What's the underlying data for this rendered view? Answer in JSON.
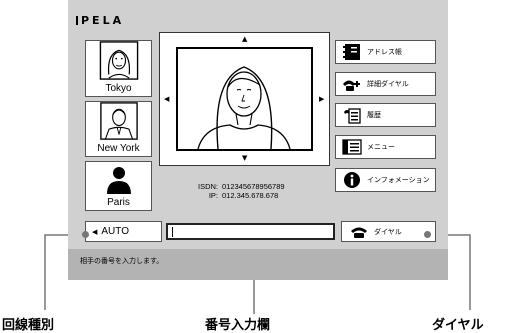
{
  "app": {
    "logo": "PELA"
  },
  "contacts": [
    {
      "name": "Tokyo",
      "icon": "woman-portrait-icon"
    },
    {
      "name": "New York",
      "icon": "man-portrait-icon"
    },
    {
      "name": "Paris",
      "icon": "person-silhouette-icon"
    }
  ],
  "preview": {
    "isdn_label": "ISDN:",
    "isdn_value": "012345678956789",
    "ip_label": "IP:",
    "ip_value": "012.345.678.678"
  },
  "menu": [
    {
      "label": "アドレス帳",
      "icon": "address-book-icon"
    },
    {
      "label": "詳細ダイヤル",
      "icon": "detail-dial-icon"
    },
    {
      "label": "履歴",
      "icon": "history-icon"
    },
    {
      "label": "メニュー",
      "icon": "menu-list-icon"
    },
    {
      "label": "インフォメーション",
      "icon": "info-icon"
    }
  ],
  "dialbar": {
    "line_type": "AUTO",
    "number_value": "",
    "dial_label": "ダイヤル"
  },
  "status": {
    "message": "相手の番号を入力します。"
  },
  "callouts": {
    "line_type": "回線種別",
    "number_field": "番号入力欄",
    "dial": "ダイヤル"
  },
  "colors": {
    "screen_bg": "#d0d0d0",
    "status_bg": "#b3b3b3",
    "leader": "#777777"
  }
}
